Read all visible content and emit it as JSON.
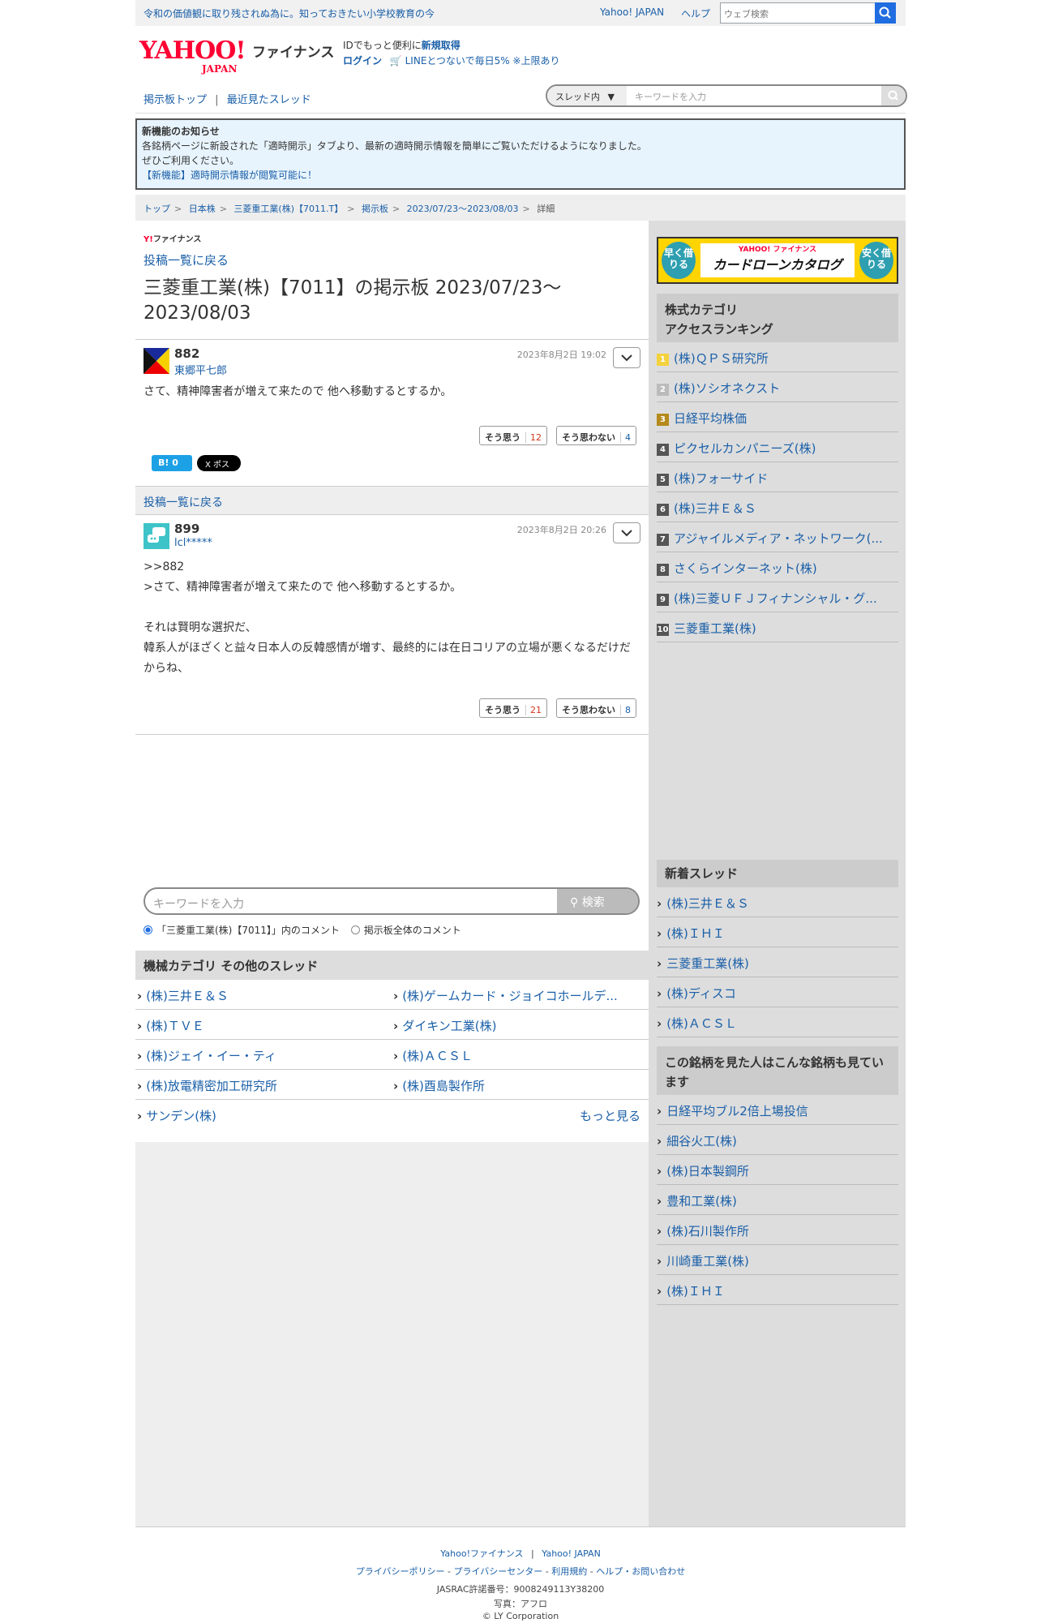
{
  "topbar": {
    "promo": "令和の価値観に取り残されぬ為に。知っておきたい小学校教育の今",
    "yahoo_japan": "Yahoo! JAPAN",
    "help": "ヘルプ",
    "search_placeholder": "ウェブ検索"
  },
  "header": {
    "logo": "YAHOO!",
    "logo_sub": "JAPAN",
    "finance": "ファイナンス",
    "id_text": "IDでもっと便利に",
    "signup": "新規取得",
    "login": "ログイン",
    "line_promo": "LINEとつないで毎日5% ※上限あり"
  },
  "nav": {
    "board_top": "掲示板トップ",
    "sep": "|",
    "recent": "最近見たスレッド",
    "scope": "スレッド内",
    "search_placeholder": "キーワードを入力"
  },
  "notice": {
    "title": "新機能のお知らせ",
    "line1": "各銘柄ページに新設された「適時開示」タブより、最新の適時開示情報を簡単にご覧いただけるようになりました。",
    "line2": "ぜひご利用ください。",
    "link": "【新機能】適時開示情報が閲覧可能に！"
  },
  "breadcrumb": [
    "トップ",
    "日本株",
    "三菱重工業(株)【7011.T】",
    "掲示板",
    "2023/07/23〜2023/08/03",
    "詳細"
  ],
  "main": {
    "yf_small": "ファイナンス",
    "back_link": "投稿一覧に戻る",
    "title": "三菱重工業(株)【7011】の掲示板 2023/07/23〜2023/08/03",
    "posts": [
      {
        "num": "882",
        "name": "東郷平七郎",
        "date": "2023年8月2日 19:02",
        "body": "さて、精神障害者が増えて来たので 他へ移動するとするか。",
        "agree": "そう思う",
        "agree_count": "12",
        "disagree": "そう思わない",
        "disagree_count": "4"
      },
      {
        "num": "899",
        "name": "lcl*****",
        "date": "2023年8月2日 20:26",
        "body": ">>882\n>さて、精神障害者が増えて来たので 他へ移動するとするか。\n\nそれは賢明な選択だ、\n韓系人がほざくと益々日本人の反韓感情が増す、最終的には在日コリアの立場が悪くなるだけだからね、",
        "agree": "そう思う",
        "agree_count": "21",
        "disagree": "そう思わない",
        "disagree_count": "8"
      }
    ],
    "hatena": "B! 0",
    "xpost": "X ポスト",
    "back_link2": "投稿一覧に戻る",
    "search_placeholder": "キーワードを入力",
    "search_button": "検索",
    "radio1": "「三菱重工業(株)【7011】」内のコメント",
    "radio2": "掲示板全体のコメント",
    "category_title": "機械カテゴリ その他のスレッド",
    "category_items": [
      [
        "(株)三井Ｅ＆Ｓ",
        "(株)ゲームカード・ジョイコホールデ..."
      ],
      [
        "(株)ＴＶＥ",
        "ダイキン工業(株)"
      ],
      [
        "(株)ジェイ・イー・ティ",
        "(株)ＡＣＳＬ"
      ],
      [
        "(株)放電精密加工研究所",
        "(株)酉島製作所"
      ],
      [
        "サンデン(株)",
        ""
      ]
    ],
    "more": "もっと見る"
  },
  "side": {
    "banner_left": "早く借りる",
    "banner_yahoo": "YAHOO! ファイナンス",
    "banner_title": "カードローンカタログ",
    "banner_right": "安く借りる",
    "ranking_title": "株式カテゴリ\nアクセスランキング",
    "ranking": [
      {
        "no": "1",
        "name": "(株)ＱＰＳ研究所"
      },
      {
        "no": "2",
        "name": "(株)ソシオネクスト"
      },
      {
        "no": "3",
        "name": "日経平均株価"
      },
      {
        "no": "4",
        "name": "ピクセルカンパニーズ(株)"
      },
      {
        "no": "5",
        "name": "(株)フォーサイド"
      },
      {
        "no": "6",
        "name": "(株)三井Ｅ＆Ｓ"
      },
      {
        "no": "7",
        "name": "アジャイルメディア・ネットワーク(..."
      },
      {
        "no": "8",
        "name": "さくらインターネット(株)"
      },
      {
        "no": "9",
        "name": "(株)三菱ＵＦＪフィナンシャル・グ..."
      },
      {
        "no": "10",
        "name": "三菱重工業(株)"
      }
    ],
    "new_title": "新着スレッド",
    "new_threads": [
      "(株)三井Ｅ＆Ｓ",
      "(株)ＩＨＩ",
      "三菱重工業(株)",
      "(株)ディスコ",
      "(株)ＡＣＳＬ"
    ],
    "viewed_title": "この銘柄を見た人はこんな銘柄も見ています",
    "viewed": [
      "日経平均ブル2倍上場投信",
      "細谷火工(株)",
      "(株)日本製鋼所",
      "豊和工業(株)",
      "(株)石川製作所",
      "川崎重工業(株)",
      "(株)ＩＨＩ"
    ]
  },
  "footer": {
    "line1a": "Yahoo!ファイナンス",
    "line1b": "Yahoo! JAPAN",
    "links": [
      "プライバシーポリシー",
      "プライバシーセンター",
      "利用規約",
      "ヘルプ・お問い合わせ"
    ],
    "jasrac": "JASRAC許諾番号：9008249113Y38200",
    "photo": "写真：アフロ",
    "copy": "© LY Corporation"
  }
}
